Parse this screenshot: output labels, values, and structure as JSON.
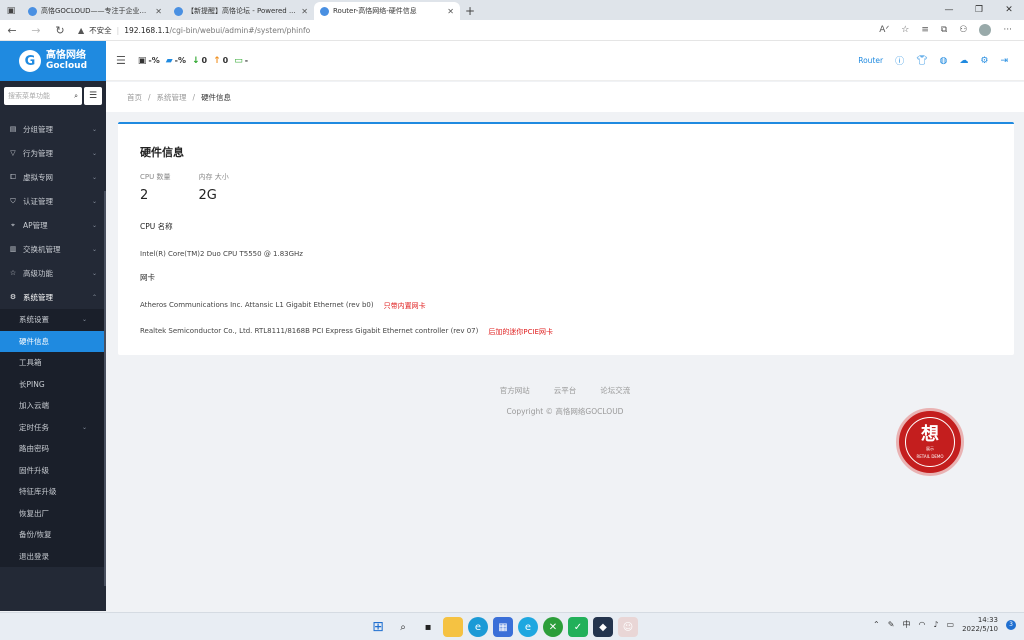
{
  "browser": {
    "tabs": [
      {
        "title": "高恪GOCLOUD——专注于企业..."
      },
      {
        "title": "【新提醒】高恪论坛 - Powered ..."
      },
      {
        "title": "Router-高恪网络-硬件信息"
      }
    ],
    "address": {
      "security_label": "不安全",
      "host": "192.168.1.1",
      "path": "/cgi-bin/webui/admin#/system/phinfo"
    }
  },
  "sidebar": {
    "logo_cn": "高恪网络",
    "logo_en": "Gocloud",
    "search_placeholder": "搜索菜单功能",
    "menu": [
      {
        "label": "分组管理"
      },
      {
        "label": "行为管理"
      },
      {
        "label": "虚拟专网"
      },
      {
        "label": "认证管理"
      },
      {
        "label": "AP管理"
      },
      {
        "label": "交换机管理"
      },
      {
        "label": "高级功能"
      },
      {
        "label": "系统管理"
      }
    ],
    "submenu": [
      {
        "label": "系统设置"
      },
      {
        "label": "硬件信息"
      },
      {
        "label": "工具箱"
      },
      {
        "label": "长PING"
      },
      {
        "label": "加入云端"
      },
      {
        "label": "定时任务"
      },
      {
        "label": "路由密码"
      },
      {
        "label": "固件升级"
      },
      {
        "label": "特征库升级"
      },
      {
        "label": "恢复出厂"
      },
      {
        "label": "备份/恢复"
      },
      {
        "label": "退出登录"
      }
    ]
  },
  "topbar": {
    "cpu": "-%",
    "mem": "-%",
    "down": "0",
    "up": "0",
    "clients": "-",
    "device_name": "Router"
  },
  "breadcrumb": {
    "home": "首页",
    "section": "系统管理",
    "current": "硬件信息"
  },
  "card": {
    "title": "硬件信息",
    "cpu_count_label": "CPU  数量",
    "cpu_count": "2",
    "mem_label": "内存  大小",
    "mem_size": "2G",
    "cpu_name_label": "CPU  名称",
    "cpu_name": "Intel(R) Core(TM)2 Duo CPU T5550 @ 1.83GHz",
    "nic_label": "网卡",
    "nics": [
      {
        "name": "Atheros Communications Inc. Attansic L1 Gigabit Ethernet (rev b0)",
        "note": "只带内置网卡"
      },
      {
        "name": "Realtek Semiconductor Co., Ltd. RTL8111/8168B PCI Express Gigabit Ethernet controller (rev 07)",
        "note": "后加的迷你PCIE网卡"
      }
    ]
  },
  "footer": {
    "links": [
      "官方网站",
      "云平台",
      "论坛交流"
    ],
    "copyright": "Copyright © 高恪网络GOCLOUD"
  },
  "stamp": {
    "char": "想",
    "sub_cn": "展示",
    "sub_en": "RETAIL DEMO"
  },
  "taskbar": {
    "ime": "中",
    "time": "14:33",
    "date": "2022/5/10",
    "notifications": "3"
  },
  "colors": {
    "accent": "#1f8ae0",
    "sidebar_bg": "#232936",
    "note_red": "#e02020"
  }
}
